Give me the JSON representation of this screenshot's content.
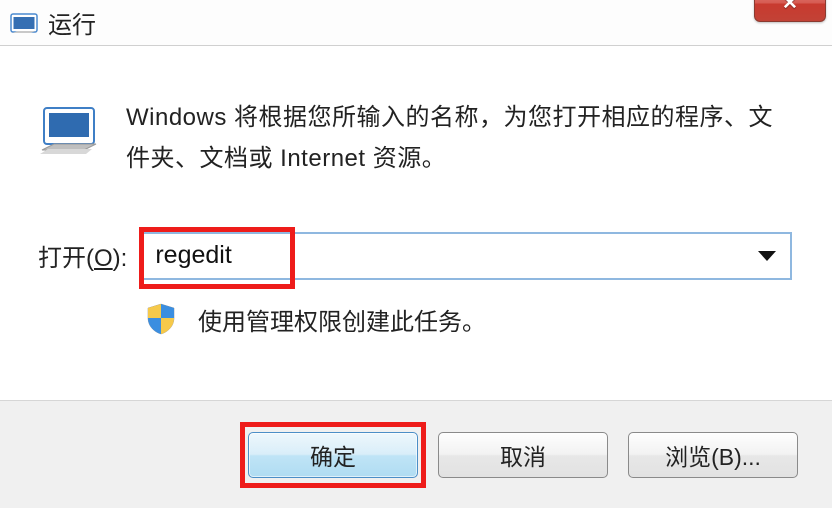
{
  "title": "运行",
  "intro": "Windows 将根据您所输入的名称，为您打开相应的程序、文件夹、文档或 Internet 资源。",
  "open_label_prefix": "打开(",
  "open_label_letter": "O",
  "open_label_suffix": "):",
  "input_value": "regedit",
  "admin_text": "使用管理权限创建此任务。",
  "buttons": {
    "ok": "确定",
    "cancel": "取消",
    "browse": "浏览(B)..."
  },
  "close_glyph": "✕"
}
